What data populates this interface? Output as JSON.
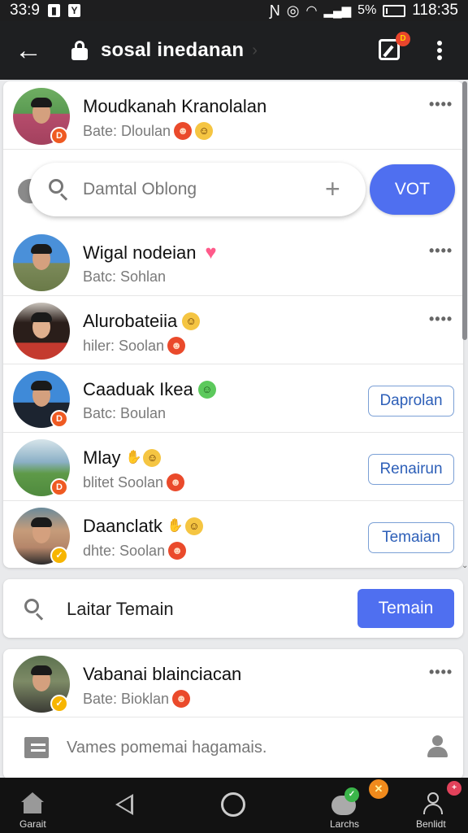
{
  "status_bar": {
    "time_left": "33:9",
    "battery_percent": "5%",
    "time_right": "118:35"
  },
  "app_bar": {
    "title": "sosal inedanan",
    "edit_badge": "D"
  },
  "search": {
    "placeholder": "Damtal Oblong",
    "vote_button": "VOT"
  },
  "contacts": [
    {
      "name": "Moudkanah Kranolalan",
      "sub": "Bate: Dloulan",
      "emojis": [
        "red",
        "yellow"
      ],
      "action": "more",
      "badge": "D"
    },
    {
      "name": "Wigal nodeian",
      "sub": "Batc: Sohlan",
      "name_emoji": "heart",
      "action": "more"
    },
    {
      "name": "Alurobateiia",
      "sub": "hiler: Soolan",
      "name_emoji": "yellow",
      "sub_emoji": "red",
      "action": "more"
    },
    {
      "name": "Caaduak Ikea",
      "sub": "Batc: Boulan",
      "name_emoji": "green",
      "action": "button",
      "action_label": "Daprolan",
      "badge": "D"
    },
    {
      "name": "Mlay",
      "sub": "blitet Soolan",
      "name_emoji": "hands-yellow",
      "sub_emoji": "red",
      "action": "button",
      "action_label": "Renairun",
      "badge": "D"
    },
    {
      "name": "Daanclatk",
      "sub": "dhte: Soolan",
      "name_emoji": "hands-yellow",
      "sub_emoji": "red",
      "action": "button",
      "action_label": "Temaian"
    }
  ],
  "secondary_search": {
    "label": "Laitar Temain",
    "button": "Temain"
  },
  "bottom_contact": {
    "name": "Vabanai blainciacan",
    "sub": "Bate: Bioklan"
  },
  "composer": {
    "placeholder": "Vames pomemai hagamais."
  },
  "nav": {
    "home_label": "Garait",
    "chats_label": "Larchs",
    "profile_label": "Benlidt"
  },
  "colors": {
    "accent_blue": "#4f6ff0",
    "outline_blue": "#2d5fb8",
    "badge_orange": "#ef5a22"
  }
}
